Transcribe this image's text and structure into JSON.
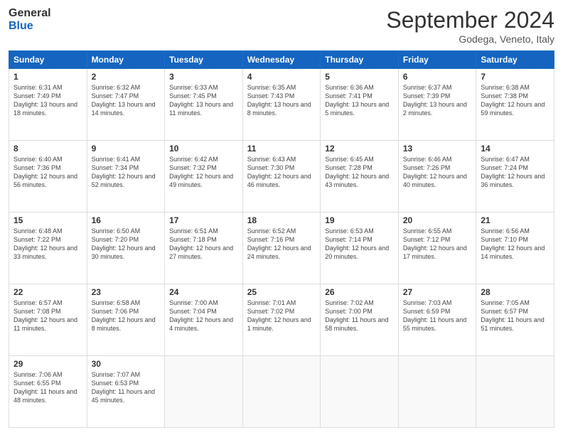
{
  "header": {
    "logo_line1": "General",
    "logo_line2": "Blue",
    "month": "September 2024",
    "location": "Godega, Veneto, Italy"
  },
  "weekdays": [
    "Sunday",
    "Monday",
    "Tuesday",
    "Wednesday",
    "Thursday",
    "Friday",
    "Saturday"
  ],
  "weeks": [
    [
      {
        "day": "1",
        "sunrise": "Sunrise: 6:31 AM",
        "sunset": "Sunset: 7:49 PM",
        "daylight": "Daylight: 13 hours and 18 minutes."
      },
      {
        "day": "2",
        "sunrise": "Sunrise: 6:32 AM",
        "sunset": "Sunset: 7:47 PM",
        "daylight": "Daylight: 13 hours and 14 minutes."
      },
      {
        "day": "3",
        "sunrise": "Sunrise: 6:33 AM",
        "sunset": "Sunset: 7:45 PM",
        "daylight": "Daylight: 13 hours and 11 minutes."
      },
      {
        "day": "4",
        "sunrise": "Sunrise: 6:35 AM",
        "sunset": "Sunset: 7:43 PM",
        "daylight": "Daylight: 13 hours and 8 minutes."
      },
      {
        "day": "5",
        "sunrise": "Sunrise: 6:36 AM",
        "sunset": "Sunset: 7:41 PM",
        "daylight": "Daylight: 13 hours and 5 minutes."
      },
      {
        "day": "6",
        "sunrise": "Sunrise: 6:37 AM",
        "sunset": "Sunset: 7:39 PM",
        "daylight": "Daylight: 13 hours and 2 minutes."
      },
      {
        "day": "7",
        "sunrise": "Sunrise: 6:38 AM",
        "sunset": "Sunset: 7:38 PM",
        "daylight": "Daylight: 12 hours and 59 minutes."
      }
    ],
    [
      {
        "day": "8",
        "sunrise": "Sunrise: 6:40 AM",
        "sunset": "Sunset: 7:36 PM",
        "daylight": "Daylight: 12 hours and 56 minutes."
      },
      {
        "day": "9",
        "sunrise": "Sunrise: 6:41 AM",
        "sunset": "Sunset: 7:34 PM",
        "daylight": "Daylight: 12 hours and 52 minutes."
      },
      {
        "day": "10",
        "sunrise": "Sunrise: 6:42 AM",
        "sunset": "Sunset: 7:32 PM",
        "daylight": "Daylight: 12 hours and 49 minutes."
      },
      {
        "day": "11",
        "sunrise": "Sunrise: 6:43 AM",
        "sunset": "Sunset: 7:30 PM",
        "daylight": "Daylight: 12 hours and 46 minutes."
      },
      {
        "day": "12",
        "sunrise": "Sunrise: 6:45 AM",
        "sunset": "Sunset: 7:28 PM",
        "daylight": "Daylight: 12 hours and 43 minutes."
      },
      {
        "day": "13",
        "sunrise": "Sunrise: 6:46 AM",
        "sunset": "Sunset: 7:26 PM",
        "daylight": "Daylight: 12 hours and 40 minutes."
      },
      {
        "day": "14",
        "sunrise": "Sunrise: 6:47 AM",
        "sunset": "Sunset: 7:24 PM",
        "daylight": "Daylight: 12 hours and 36 minutes."
      }
    ],
    [
      {
        "day": "15",
        "sunrise": "Sunrise: 6:48 AM",
        "sunset": "Sunset: 7:22 PM",
        "daylight": "Daylight: 12 hours and 33 minutes."
      },
      {
        "day": "16",
        "sunrise": "Sunrise: 6:50 AM",
        "sunset": "Sunset: 7:20 PM",
        "daylight": "Daylight: 12 hours and 30 minutes."
      },
      {
        "day": "17",
        "sunrise": "Sunrise: 6:51 AM",
        "sunset": "Sunset: 7:18 PM",
        "daylight": "Daylight: 12 hours and 27 minutes."
      },
      {
        "day": "18",
        "sunrise": "Sunrise: 6:52 AM",
        "sunset": "Sunset: 7:16 PM",
        "daylight": "Daylight: 12 hours and 24 minutes."
      },
      {
        "day": "19",
        "sunrise": "Sunrise: 6:53 AM",
        "sunset": "Sunset: 7:14 PM",
        "daylight": "Daylight: 12 hours and 20 minutes."
      },
      {
        "day": "20",
        "sunrise": "Sunrise: 6:55 AM",
        "sunset": "Sunset: 7:12 PM",
        "daylight": "Daylight: 12 hours and 17 minutes."
      },
      {
        "day": "21",
        "sunrise": "Sunrise: 6:56 AM",
        "sunset": "Sunset: 7:10 PM",
        "daylight": "Daylight: 12 hours and 14 minutes."
      }
    ],
    [
      {
        "day": "22",
        "sunrise": "Sunrise: 6:57 AM",
        "sunset": "Sunset: 7:08 PM",
        "daylight": "Daylight: 12 hours and 11 minutes."
      },
      {
        "day": "23",
        "sunrise": "Sunrise: 6:58 AM",
        "sunset": "Sunset: 7:06 PM",
        "daylight": "Daylight: 12 hours and 8 minutes."
      },
      {
        "day": "24",
        "sunrise": "Sunrise: 7:00 AM",
        "sunset": "Sunset: 7:04 PM",
        "daylight": "Daylight: 12 hours and 4 minutes."
      },
      {
        "day": "25",
        "sunrise": "Sunrise: 7:01 AM",
        "sunset": "Sunset: 7:02 PM",
        "daylight": "Daylight: 12 hours and 1 minute."
      },
      {
        "day": "26",
        "sunrise": "Sunrise: 7:02 AM",
        "sunset": "Sunset: 7:00 PM",
        "daylight": "Daylight: 11 hours and 58 minutes."
      },
      {
        "day": "27",
        "sunrise": "Sunrise: 7:03 AM",
        "sunset": "Sunset: 6:59 PM",
        "daylight": "Daylight: 11 hours and 55 minutes."
      },
      {
        "day": "28",
        "sunrise": "Sunrise: 7:05 AM",
        "sunset": "Sunset: 6:57 PM",
        "daylight": "Daylight: 11 hours and 51 minutes."
      }
    ],
    [
      {
        "day": "29",
        "sunrise": "Sunrise: 7:06 AM",
        "sunset": "Sunset: 6:55 PM",
        "daylight": "Daylight: 11 hours and 48 minutes."
      },
      {
        "day": "30",
        "sunrise": "Sunrise: 7:07 AM",
        "sunset": "Sunset: 6:53 PM",
        "daylight": "Daylight: 11 hours and 45 minutes."
      },
      null,
      null,
      null,
      null,
      null
    ]
  ]
}
